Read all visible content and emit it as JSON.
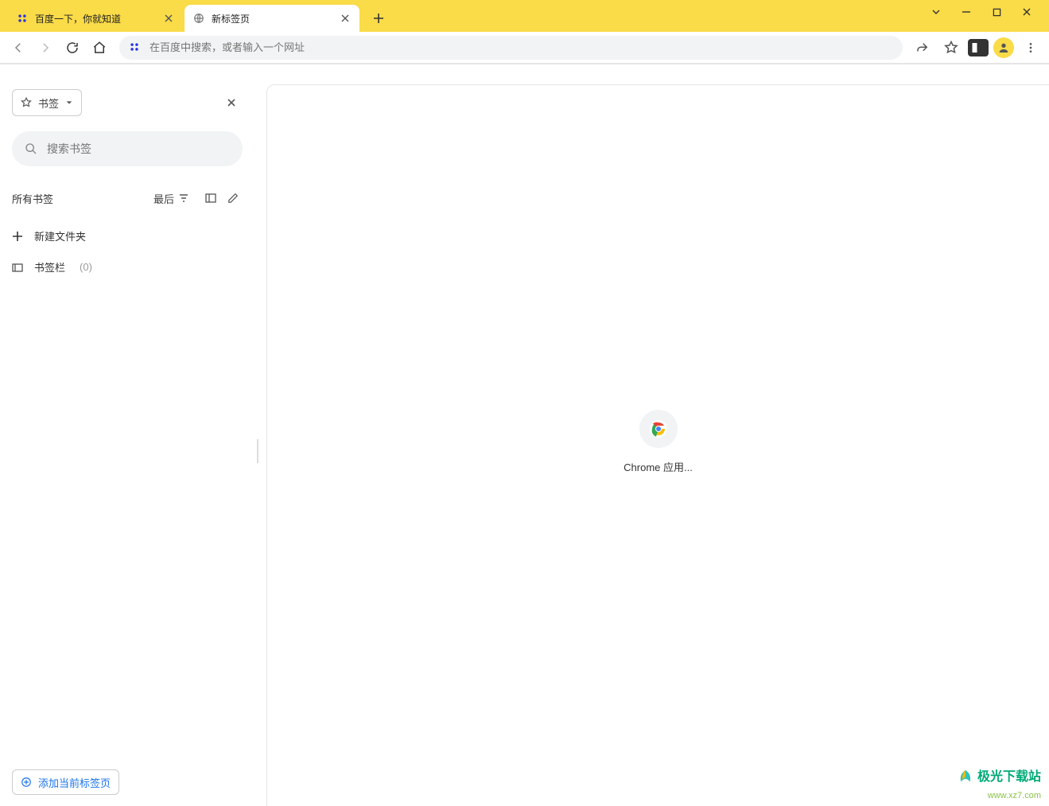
{
  "tabs": {
    "t0_title": "百度一下，你就知道",
    "t1_title": "新标签页"
  },
  "addressbar": {
    "placeholder": "在百度中搜索，或者输入一个网址"
  },
  "sidebar": {
    "dropdown_label": "书签",
    "search_placeholder": "搜索书签",
    "all_bookmarks_label": "所有书签",
    "sort_label": "最后",
    "new_folder_label": "新建文件夹",
    "bookmark_bar_label": "书签栏",
    "bookmark_bar_count": "(0)",
    "add_current_tab_label": "添加当前标签页"
  },
  "main": {
    "app_label": "Chrome 应用..."
  },
  "watermark": {
    "name": "极光下载站",
    "url": "www.xz7.com"
  }
}
